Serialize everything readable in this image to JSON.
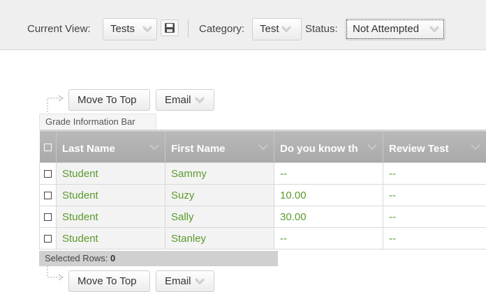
{
  "filter_bar": {
    "current_view_label": "Current View:",
    "current_view_value": "Tests",
    "category_label": "Category:",
    "category_value": "Test",
    "status_label": "Status:",
    "status_value": "Not Attempted",
    "save_icon": "floppy-disk-icon"
  },
  "actions_top": {
    "move_to_top_label": "Move To Top",
    "email_label": "Email"
  },
  "grade_info_bar": "Grade Information Bar",
  "grid": {
    "columns": [
      {
        "label": "Last Name"
      },
      {
        "label": "First Name"
      },
      {
        "label": "Do you know th"
      },
      {
        "label": "Review Test"
      }
    ],
    "rows": [
      {
        "last": "Student",
        "first": "Sammy",
        "q1": "--",
        "review": "--"
      },
      {
        "last": "Student",
        "first": "Suzy",
        "q1": "10.00",
        "review": "--"
      },
      {
        "last": "Student",
        "first": "Sally",
        "q1": "30.00",
        "review": "--"
      },
      {
        "last": "Student",
        "first": "Stanley",
        "q1": "--",
        "review": "--"
      }
    ]
  },
  "selected_rows": {
    "label": "Selected Rows:",
    "count": "0"
  },
  "actions_bottom": {
    "move_to_top_label": "Move To Top",
    "email_label": "Email"
  },
  "colors": {
    "link_green": "#5a9a2b",
    "header_gray": "#b0b0b0",
    "filter_bar_bg": "#efefef"
  }
}
